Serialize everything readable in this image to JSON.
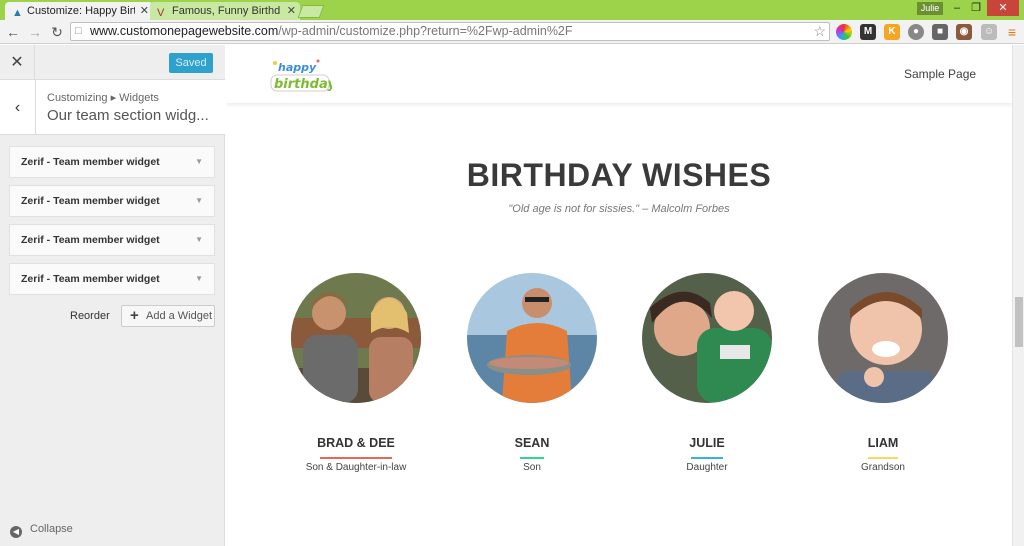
{
  "browser": {
    "tabs": [
      {
        "title": "Customize: Happy Birthda",
        "active": true
      },
      {
        "title": "Famous, Funny Birthday Q",
        "active": false
      }
    ],
    "user_badge": "Julie",
    "url": {
      "host": "www.customonepagewebsite.com",
      "path": "/wp-admin/customize.php?return=%2Fwp-admin%2F"
    }
  },
  "sidebar": {
    "saved_label": "Saved",
    "breadcrumb": "Customizing ▸ Widgets",
    "section_title": "Our team section widg...",
    "widgets": [
      {
        "label": "Zerif - Team member widget"
      },
      {
        "label": "Zerif - Team member widget"
      },
      {
        "label": "Zerif - Team member widget"
      },
      {
        "label": "Zerif - Team member widget"
      }
    ],
    "reorder_label": "Reorder",
    "add_widget_label": "Add a Widget",
    "collapse_label": "Collapse"
  },
  "site": {
    "logo_text": "happy birthday",
    "nav_link": "Sample Page",
    "heading": "BIRTHDAY WISHES",
    "quote": "\"Old age is not for sissies.\" – Malcolm Forbes",
    "members": [
      {
        "name": "BRAD & DEE",
        "role": "Son & Daughter-in-law",
        "color": "#e96656"
      },
      {
        "name": "SEAN",
        "role": "Son",
        "color": "#34d293"
      },
      {
        "name": "JULIE",
        "role": "Daughter",
        "color": "#3ab0e2"
      },
      {
        "name": "LIAM",
        "role": "Grandson",
        "color": "#f7d861"
      }
    ]
  }
}
